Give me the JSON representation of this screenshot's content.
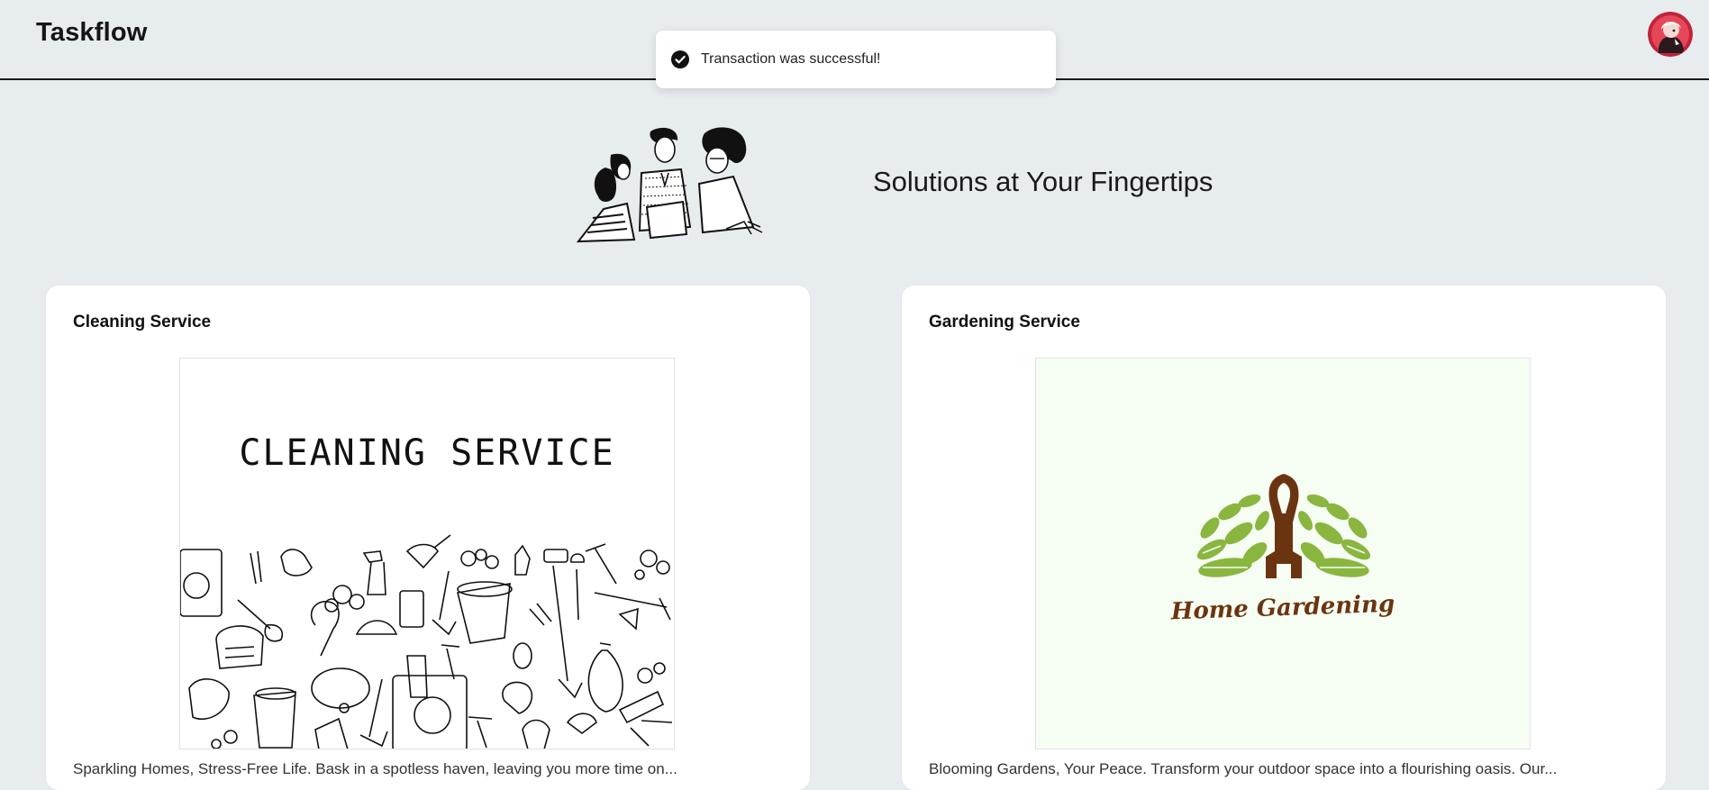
{
  "header": {
    "app_title": "Taskflow",
    "avatar_icon": "user-avatar"
  },
  "toast": {
    "icon": "check-circle-icon",
    "message": "Transaction was successful!"
  },
  "hero": {
    "title": "Solutions at Your Fingertips",
    "illustration": "people-illustration"
  },
  "services": [
    {
      "title": "Cleaning Service",
      "image_text": "CLEANING SERVICE",
      "description": "Sparkling Homes, Stress-Free Life. Bask in a spotless haven, leaving you more time on..."
    },
    {
      "title": "Gardening Service",
      "image_text": "Home Gardening",
      "description": "Blooming Gardens, Your Peace. Transform your outdoor space into a flourishing oasis. Our..."
    }
  ],
  "colors": {
    "background": "#e7ecef",
    "card": "#ffffff",
    "garden_leaf": "#8ab640",
    "garden_brown": "#6b3410"
  }
}
